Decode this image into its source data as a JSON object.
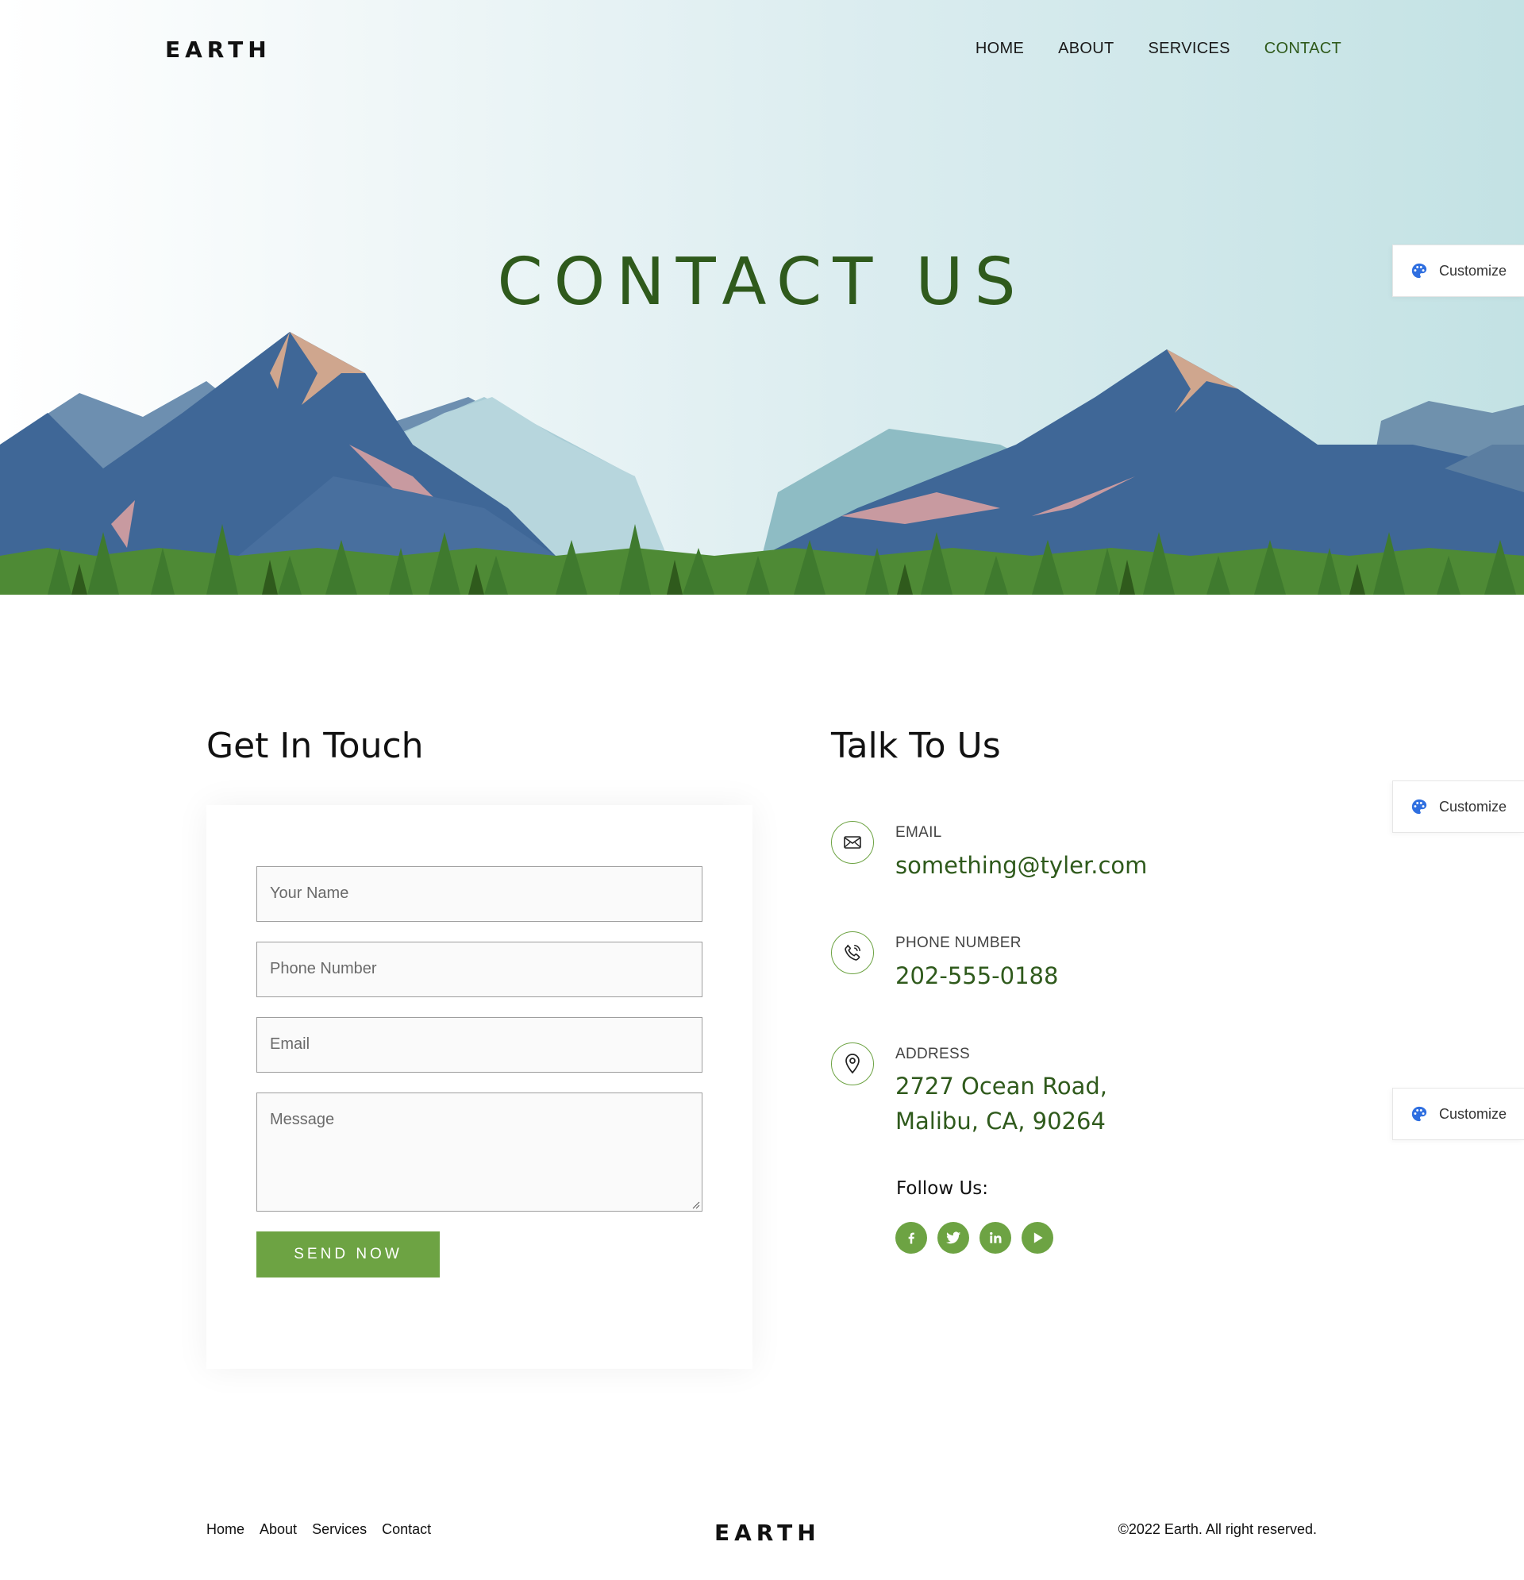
{
  "brand": {
    "name": "EARTH"
  },
  "nav": {
    "items": [
      {
        "label": "HOME"
      },
      {
        "label": "ABOUT"
      },
      {
        "label": "SERVICES"
      },
      {
        "label": "CONTACT"
      }
    ],
    "active": "CONTACT"
  },
  "hero": {
    "title": "CONTACT US"
  },
  "customize": {
    "label": "Customize"
  },
  "form": {
    "title": "Get In Touch",
    "name_placeholder": "Your Name",
    "phone_placeholder": "Phone Number",
    "email_placeholder": "Email",
    "message_placeholder": "Message",
    "submit_label": "SEND NOW"
  },
  "contact": {
    "title": "Talk To Us",
    "email_label": "EMAIL",
    "email_value": "something@tyler.com",
    "phone_label": "PHONE NUMBER",
    "phone_value": "202-555-0188",
    "address_label": "ADDRESS",
    "address_line1": "2727 Ocean Road,",
    "address_line2": "Malibu, CA, 90264",
    "follow_label": "Follow Us:",
    "socials": [
      "facebook-icon",
      "twitter-icon",
      "linkedin-icon",
      "youtube-icon"
    ]
  },
  "footer": {
    "links": [
      {
        "label": "Home"
      },
      {
        "label": "About"
      },
      {
        "label": "Services"
      },
      {
        "label": "Contact"
      }
    ],
    "copyright": "©2022 Earth. All right reserved."
  },
  "colors": {
    "accent_green": "#6da343",
    "dark_green": "#2f5a1c",
    "customize_blue": "#2f6fe0"
  }
}
